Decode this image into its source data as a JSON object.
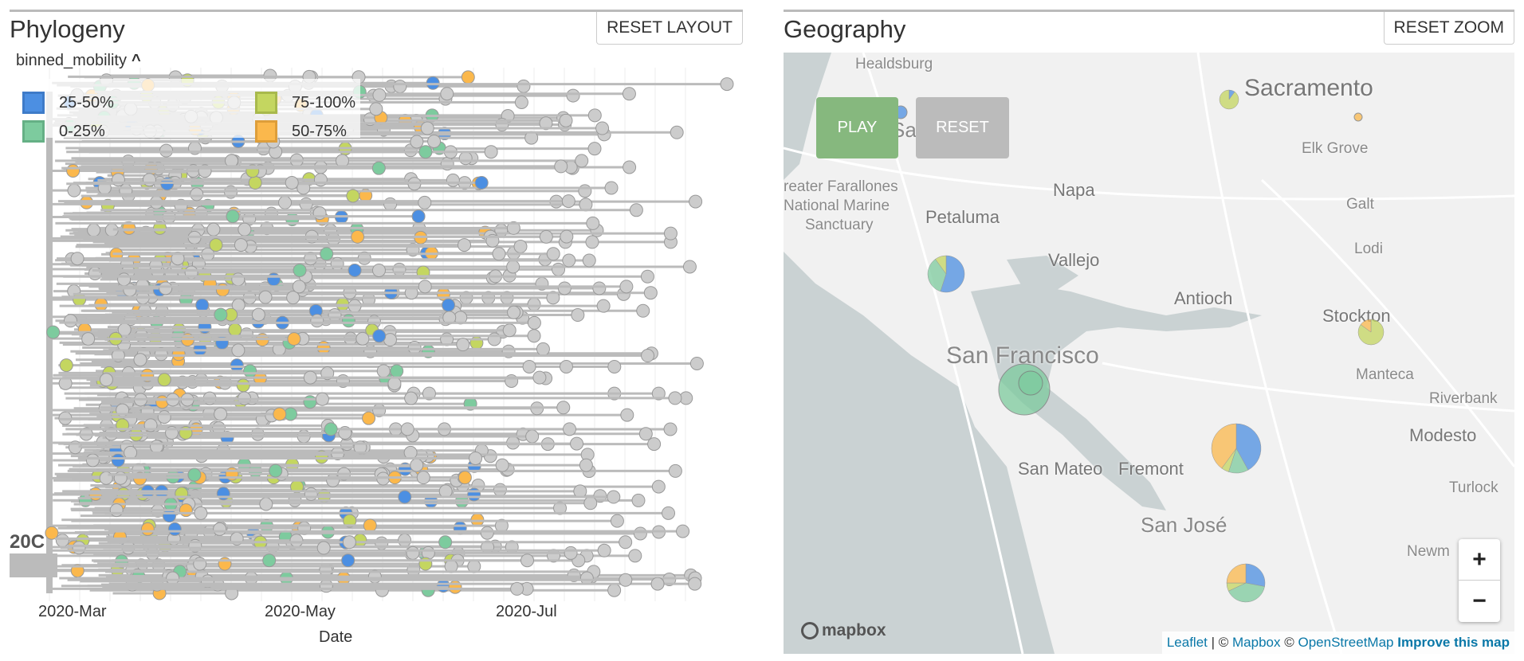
{
  "phylogeny": {
    "title": "Phylogeny",
    "reset_label": "RESET LAYOUT",
    "color_by": "binned_mobility",
    "legend": [
      {
        "label": "25-50%",
        "color": "#4C8FE2"
      },
      {
        "label": "0-25%",
        "color": "#7DCB9E"
      },
      {
        "label": "75-100%",
        "color": "#C4D660"
      },
      {
        "label": "50-75%",
        "color": "#FBB84C"
      }
    ],
    "unknown_color": "#CCCCCC",
    "clade_label": "20C",
    "x_ticks": [
      "2020-Mar",
      "2020-May",
      "2020-Jul"
    ],
    "x_label": "Date"
  },
  "geography": {
    "title": "Geography",
    "reset_label": "RESET ZOOM",
    "play_label": "PLAY",
    "reset_anim_label": "RESET",
    "play_color": "#86B87E",
    "zoom_in": "+",
    "zoom_out": "−",
    "place_labels": [
      "Healdsburg",
      "Sacramento",
      "Elk Grove",
      "Napa",
      "Galt",
      "Petaluma",
      "reater Farallones",
      "National Marine",
      "Sanctuary",
      "Lodi",
      "Vallejo",
      "Antioch",
      "Stockton",
      "San Francisco",
      "Manteca",
      "Riverbank",
      "Modesto",
      "San Mateo",
      "Fremont",
      "Turlock",
      "San José",
      "Newm",
      "Sa"
    ],
    "pies": [
      {
        "fractions": {
          "75-100%": 0.9,
          "25-50%": 0.1
        }
      },
      {
        "fractions": {
          "50-75%": 1.0
        }
      },
      {
        "fractions": {
          "25-50%": 1.0
        }
      },
      {
        "fractions": {
          "25-50%": 0.55,
          "0-25%": 0.35,
          "75-100%": 0.1
        }
      },
      {
        "fractions": {
          "0-25%": 1.0
        }
      },
      {
        "fractions": {
          "0-25%": 1.0
        }
      },
      {
        "fractions": {
          "75-100%": 0.85,
          "50-75%": 0.15
        }
      },
      {
        "fractions": {
          "25-50%": 0.42,
          "0-25%": 0.13,
          "75-100%": 0.05,
          "50-75%": 0.4
        }
      },
      {
        "fractions": {
          "25-50%": 0.28,
          "0-25%": 0.4,
          "75-100%": 0.07,
          "50-75%": 0.25
        }
      }
    ],
    "mapbox_logo": "mapbox",
    "attribution": {
      "leaflet": "Leaflet",
      "sep": " | © ",
      "mapbox": "Mapbox",
      "copy": " © ",
      "osm": "OpenStreetMap",
      "improve": "Improve this map"
    }
  }
}
